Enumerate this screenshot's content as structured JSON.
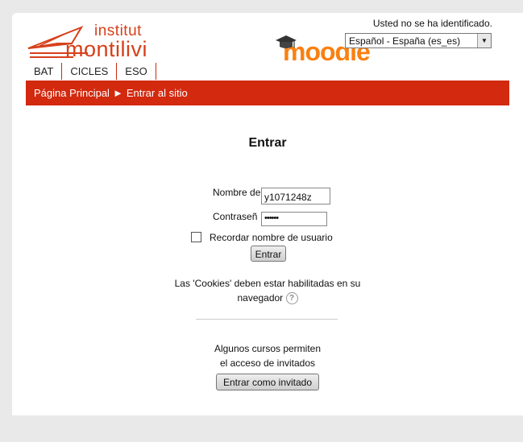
{
  "logo": {
    "line1": "institut",
    "line2": "montilivi"
  },
  "brand": {
    "name": "moodle"
  },
  "header": {
    "login_info": "Usted no se ha identificado.",
    "language_selected": "Español - España (es_es)"
  },
  "nav": {
    "items": [
      {
        "label": "BAT"
      },
      {
        "label": "CICLES"
      },
      {
        "label": "ESO"
      }
    ]
  },
  "breadcrumb": {
    "home": "Página Principal",
    "separator": "►",
    "current": "Entrar al sitio"
  },
  "login": {
    "title": "Entrar",
    "username_label": "Nombre de",
    "username_value": "y1071248z",
    "password_label": "Contraseñ",
    "password_value": "••••••",
    "remember_label": "Recordar nombre de usuario",
    "submit_label": "Entrar",
    "cookies_line1": "Las 'Cookies' deben estar habilitadas en su",
    "cookies_line2": "navegador",
    "guest_line1": "Algunos cursos permiten",
    "guest_line2": "el acceso de invitados",
    "guest_button": "Entrar como invitado"
  },
  "colors": {
    "accent": "#d2290f",
    "logo": "#d6401a",
    "moodle": "#f98012"
  },
  "icons": {
    "help": "help-icon",
    "cap": "graduation-cap-icon",
    "logo": "paper-plane-logo"
  }
}
